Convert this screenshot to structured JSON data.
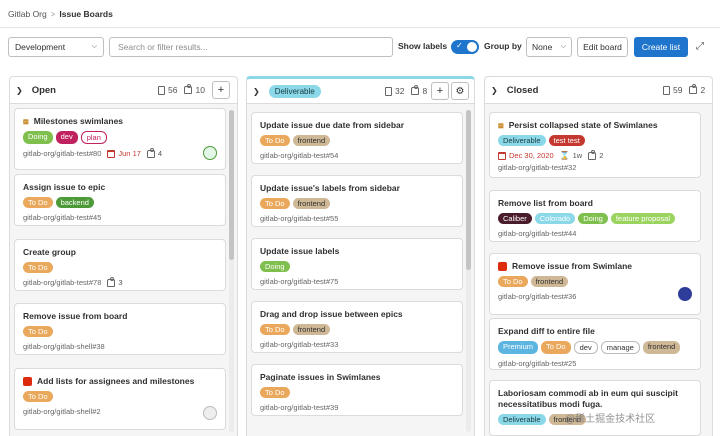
{
  "breadcrumb": {
    "group": "Gitlab Org",
    "separator": ">",
    "current": "Issue Boards"
  },
  "filterbar": {
    "milestone": "Development",
    "search_placeholder": "Search or filter results...",
    "show_labels": "Show labels",
    "toggle_on": true,
    "group_by": "Group by",
    "group_value": "None",
    "edit_board": "Edit board",
    "create_list": "Create list"
  },
  "colors": {
    "accent": "#1f75cb",
    "deliverable": "#8ad8e8",
    "due_red": "#c4382f"
  },
  "lists": [
    {
      "title": "Open",
      "issues": "56",
      "weight": "10",
      "cards": [
        {
          "icon": "epic-icon",
          "title": "Milestones swimlanes",
          "labels": [
            {
              "text": "Doing",
              "bg": "#7fbf4d",
              "fg": "#fff"
            },
            {
              "text": "dev",
              "bg": "#c0215f",
              "fg": "#fff"
            },
            {
              "text": "plan",
              "bg": "#fff",
              "fg": "#c0215f"
            }
          ],
          "ref": "gitlab-org/gitlab-test#80",
          "due": "Jun 17",
          "weight": "4"
        },
        {
          "icon": "",
          "title": "Assign issue to epic",
          "labels": [
            {
              "text": "To Do",
              "bg": "#e9a85b",
              "fg": "#fff"
            },
            {
              "text": "backend",
              "bg": "#4d9a39",
              "fg": "#fff"
            }
          ],
          "ref": "gitlab-org/gitlab-test#45"
        },
        {
          "icon": "",
          "title": "Create group",
          "labels": [
            {
              "text": "To Do",
              "bg": "#e9a85b",
              "fg": "#fff"
            }
          ],
          "ref": "gitlab-org/gitlab-test#78",
          "weight": "3"
        },
        {
          "icon": "",
          "title": "Remove issue from board",
          "labels": [
            {
              "text": "To Do",
              "bg": "#e9a85b",
              "fg": "#fff"
            }
          ],
          "ref": "gitlab-org/gitlab-shell#38"
        },
        {
          "icon": "blocked-icon",
          "title": "Add lists for assignees and milestones",
          "labels": [
            {
              "text": "To Do",
              "bg": "#e9a85b",
              "fg": "#fff"
            }
          ],
          "ref": "gitlab-org/gitlab-shell#2"
        }
      ]
    },
    {
      "title": "Deliverable",
      "issues": "32",
      "weight": "8",
      "cards": [
        {
          "title": "Update issue due date from sidebar",
          "labels": [
            {
              "text": "To Do",
              "bg": "#e9a85b",
              "fg": "#fff"
            },
            {
              "text": "frontend",
              "bg": "#cfb896",
              "fg": "#303030"
            }
          ],
          "ref": "gitlab-org/gitlab-test#54"
        },
        {
          "title": "Update issue's labels from sidebar",
          "labels": [
            {
              "text": "To Do",
              "bg": "#e9a85b",
              "fg": "#fff"
            },
            {
              "text": "frontend",
              "bg": "#cfb896",
              "fg": "#303030"
            }
          ],
          "ref": "gitlab-org/gitlab-test#55"
        },
        {
          "title": "Update issue labels",
          "labels": [
            {
              "text": "Doing",
              "bg": "#7fbf4d",
              "fg": "#fff"
            }
          ],
          "ref": "gitlab-org/gitlab-test#75"
        },
        {
          "title": "Drag and drop issue between epics",
          "labels": [
            {
              "text": "To Do",
              "bg": "#e9a85b",
              "fg": "#fff"
            },
            {
              "text": "frontend",
              "bg": "#cfb896",
              "fg": "#303030"
            }
          ],
          "ref": "gitlab-org/gitlab-test#33"
        },
        {
          "title": "Paginate issues in Swimlanes",
          "labels": [
            {
              "text": "To Do",
              "bg": "#e9a85b",
              "fg": "#fff"
            }
          ],
          "ref": "gitlab-org/gitlab-test#39"
        }
      ]
    },
    {
      "title": "Closed",
      "issues": "59",
      "weight": "2",
      "cards": [
        {
          "icon": "epic-icon",
          "title": "Persist collapsed state of Swimlanes",
          "labels": [
            {
              "text": "Deliverable",
              "bg": "#8ad8e8",
              "fg": "#1a3a40"
            },
            {
              "text": "test test",
              "bg": "#c4382f",
              "fg": "#fff"
            }
          ],
          "ref": "gitlab-org/gitlab-test#32",
          "due": "Dec 30, 2020",
          "time": "1w",
          "weight": "2"
        },
        {
          "icon": "",
          "title": "Remove list from board",
          "labels": [
            {
              "text": "Caliber",
              "bg": "#4a1b2b",
              "fg": "#fff"
            },
            {
              "text": "Colorado",
              "bg": "#8ad8e8",
              "fg": "#fff"
            },
            {
              "text": "Doing",
              "bg": "#7fbf4d",
              "fg": "#fff"
            },
            {
              "text": "feature proposal",
              "bg": "#9bd35f",
              "fg": "#fff"
            }
          ],
          "ref": "gitlab-org/gitlab-test#44"
        },
        {
          "icon": "blocked-icon",
          "title": "Remove issue from Swimlane",
          "labels": [
            {
              "text": "To Do",
              "bg": "#e9a85b",
              "fg": "#fff"
            },
            {
              "text": "frontend",
              "bg": "#cfb896",
              "fg": "#303030"
            }
          ],
          "ref": "gitlab-org/gitlab-test#36"
        },
        {
          "icon": "",
          "title": "Expand diff to entire file",
          "labels": [
            {
              "text": "Premium",
              "bg": "#5cb4e0",
              "fg": "#fff"
            },
            {
              "text": "To Do",
              "bg": "#e9a85b",
              "fg": "#fff"
            },
            {
              "text": "dev",
              "bg": "#fff",
              "fg": "#303030"
            },
            {
              "text": "manage",
              "bg": "#fff",
              "fg": "#303030"
            },
            {
              "text": "frontend",
              "bg": "#cfb896",
              "fg": "#303030"
            }
          ],
          "ref": "gitlab-org/gitlab-test#25"
        },
        {
          "icon": "",
          "title": "Laboriosam commodi ab in eum qui suscipit necessitatibus modi fuga.",
          "labels": [
            {
              "text": "Deliverable",
              "bg": "#8ad8e8",
              "fg": "#1a3a40"
            },
            {
              "text": "frontend",
              "bg": "#cfb896",
              "fg": "#303030"
            }
          ],
          "ref": ""
        }
      ]
    }
  ],
  "watermark": "@稀土掘金技术社区"
}
